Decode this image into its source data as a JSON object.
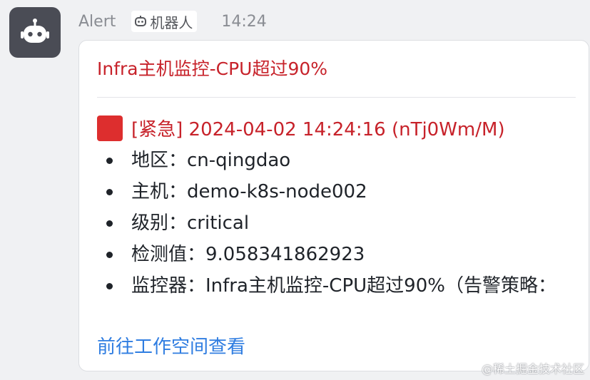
{
  "message": {
    "sender": "Alert",
    "robot_tag": "机器人",
    "time": "14:24"
  },
  "card": {
    "title": "Infra主机监控-CPU超过90%",
    "urgent_line": "[紧急] 2024-04-02 14:24:16 (nTj0Wm/M)",
    "details": [
      {
        "text": "地区：cn-qingdao"
      },
      {
        "text": "主机：demo-k8s-node002"
      },
      {
        "text": "级别：critical"
      },
      {
        "text": "检测值：9.058341862923"
      },
      {
        "text": "监控器：Infra主机监控-CPU超过90%（告警策略："
      }
    ],
    "link": "前往工作空间查看"
  },
  "watermark": "@稀土掘金技术社区",
  "icons": {
    "avatar": "robot-icon",
    "tag": "robot-icon",
    "urgent": "red-square-icon"
  },
  "colors": {
    "alert_red": "#c7222a",
    "link_blue": "#2f7de1",
    "avatar_bg": "#4a4c55"
  }
}
